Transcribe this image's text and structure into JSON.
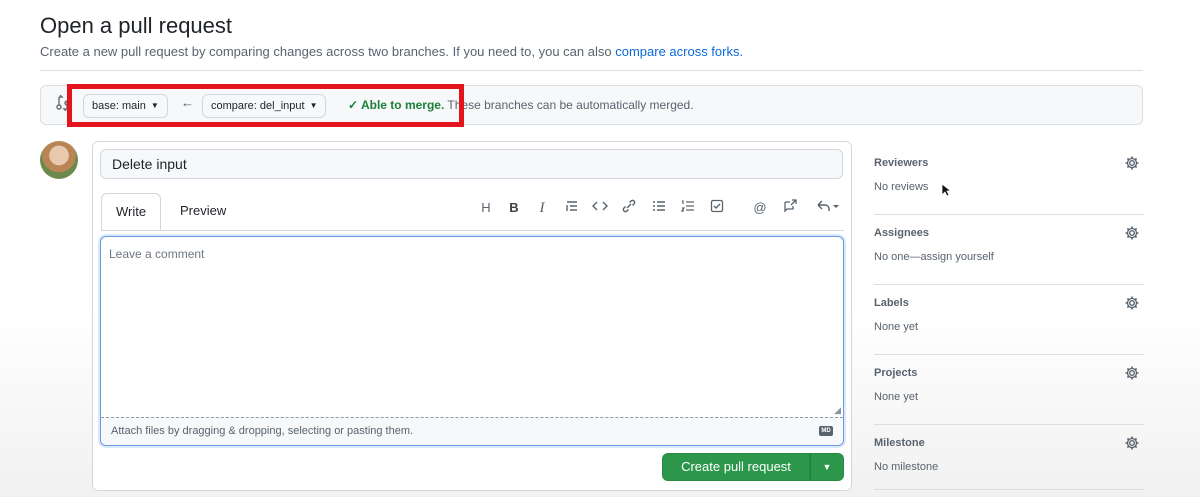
{
  "page": {
    "title": "Open a pull request",
    "subtitle_text": "Create a new pull request by comparing changes across two branches. If you need to, you can also ",
    "subtitle_link": "compare across forks."
  },
  "range": {
    "base_label": "base: main",
    "compare_label": "compare: del_input",
    "merge_ok": "✓ Able to merge.",
    "merge_text": "These branches can be automatically merged."
  },
  "form": {
    "title_value": "Delete input",
    "tabs": [
      {
        "label": "Write",
        "active": true
      },
      {
        "label": "Preview",
        "active": false
      }
    ],
    "toolbar": [
      {
        "name": "heading-icon",
        "glyph": "H"
      },
      {
        "name": "bold-icon",
        "glyph": "B"
      },
      {
        "name": "italic-icon",
        "glyph": "I"
      },
      {
        "name": "quote-icon",
        "glyph": "☰"
      },
      {
        "name": "code-icon",
        "glyph": "<>"
      },
      {
        "name": "link-icon",
        "glyph": "🔗"
      },
      {
        "name": "bulleted-list-icon",
        "glyph": "☰"
      },
      {
        "name": "numbered-list-icon",
        "glyph": "☰"
      },
      {
        "name": "task-list-icon",
        "glyph": "☑"
      },
      {
        "name": "mention-icon",
        "glyph": "@"
      },
      {
        "name": "reference-icon",
        "glyph": "↗"
      },
      {
        "name": "undo-icon",
        "glyph": "↶"
      }
    ],
    "comment_placeholder": "Leave a comment",
    "attach_text": "Attach files by dragging & dropping, selecting or pasting them.",
    "markdown_badge": "MD",
    "submit_label": "Create pull request"
  },
  "sidebar": [
    {
      "heading": "Reviewers",
      "value": "No reviews"
    },
    {
      "heading": "Assignees",
      "value": "No one—assign yourself"
    },
    {
      "heading": "Labels",
      "value": "None yet"
    },
    {
      "heading": "Projects",
      "value": "None yet"
    },
    {
      "heading": "Milestone",
      "value": "No milestone"
    }
  ],
  "colors": {
    "accent_link": "#0969da",
    "merge_ok": "#1a7f37",
    "submit_green": "#2c974b",
    "highlight_red": "#e3141c"
  }
}
